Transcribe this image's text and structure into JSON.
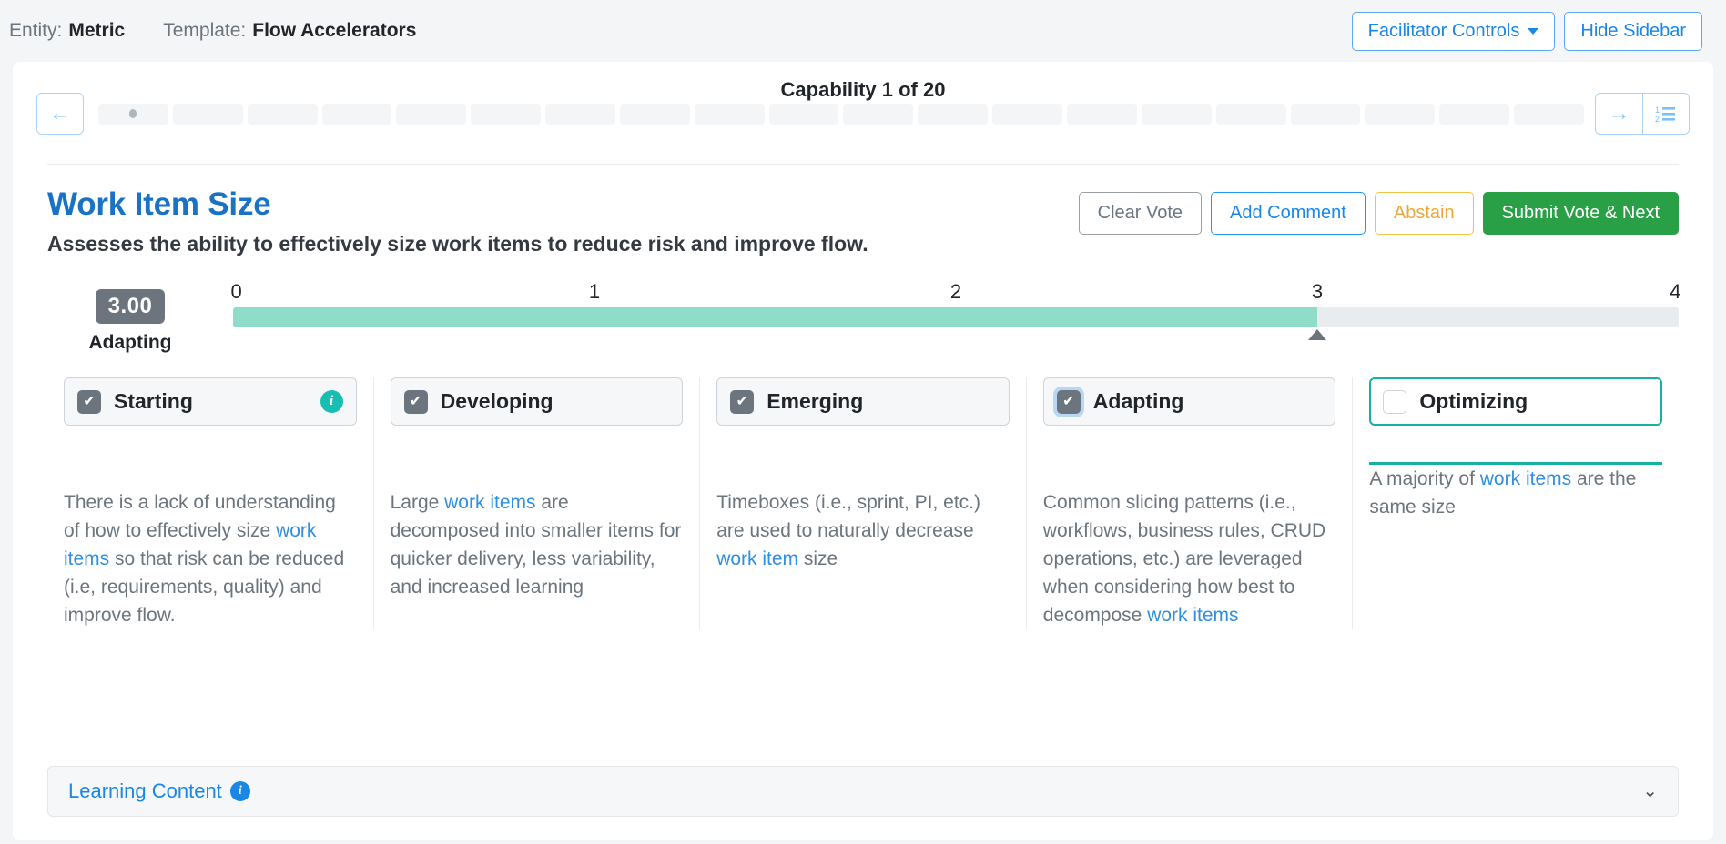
{
  "topbar": {
    "entity_label": "Entity:",
    "entity_value": "Metric",
    "template_label": "Template:",
    "template_value": "Flow Accelerators",
    "facilitator_controls": "Facilitator Controls",
    "hide_sidebar": "Hide Sidebar"
  },
  "nav": {
    "capability_counter": "Capability 1 of 20",
    "back_icon": "←",
    "forward_icon": "→",
    "list_icon": "☰",
    "total_segments": 20,
    "current_index": 1
  },
  "capability": {
    "name": "Work Item Size",
    "description": "Assesses the ability to effectively size work items to reduce risk and improve flow."
  },
  "actions": {
    "clear_vote": "Clear Vote",
    "add_comment": "Add Comment",
    "abstain": "Abstain",
    "submit": "Submit Vote & Next"
  },
  "gauge": {
    "score": "3.00",
    "score_label": "Adapting",
    "ticks": [
      "0",
      "1",
      "2",
      "3",
      "4"
    ],
    "min": 0,
    "max": 4,
    "value": 3,
    "fill_color": "#8fdcc9",
    "track_color": "#e9ecef",
    "marker_color": "#6c757d"
  },
  "levels": [
    {
      "name": "Starting",
      "checked": true,
      "selected": false,
      "focused": false,
      "has_info": true,
      "info_glyph": "i",
      "check_glyph": "✔",
      "text_parts": [
        {
          "t": "There is a lack of understanding of how to effectively size ",
          "link": false
        },
        {
          "t": "work items",
          "link": true
        },
        {
          "t": " so that risk can be reduced (i.e, requirements, quality) and improve flow.",
          "link": false
        }
      ]
    },
    {
      "name": "Developing",
      "checked": true,
      "selected": false,
      "focused": false,
      "has_info": false,
      "check_glyph": "✔",
      "text_parts": [
        {
          "t": "Large ",
          "link": false
        },
        {
          "t": "work items",
          "link": true
        },
        {
          "t": " are decomposed into smaller items for quicker delivery, less variability, and increased learning",
          "link": false
        }
      ]
    },
    {
      "name": "Emerging",
      "checked": true,
      "selected": false,
      "focused": false,
      "has_info": false,
      "check_glyph": "✔",
      "text_parts": [
        {
          "t": "Timeboxes (i.e., sprint, PI, etc.) are used to naturally decrease ",
          "link": false
        },
        {
          "t": "work item",
          "link": true
        },
        {
          "t": " size",
          "link": false
        }
      ]
    },
    {
      "name": "Adapting",
      "checked": true,
      "selected": false,
      "focused": true,
      "has_info": false,
      "check_glyph": "✔",
      "text_parts": [
        {
          "t": "Common slicing patterns (i.e., workflows, business rules, CRUD operations, etc.) are leveraged when considering how best to decompose ",
          "link": false
        },
        {
          "t": "work items",
          "link": true
        }
      ]
    },
    {
      "name": "Optimizing",
      "checked": false,
      "selected": true,
      "focused": false,
      "has_info": false,
      "check_glyph": "",
      "text_parts": [
        {
          "t": "A majority of ",
          "link": false
        },
        {
          "t": "work items",
          "link": true
        },
        {
          "t": " are the same size",
          "link": false
        }
      ]
    }
  ],
  "learning": {
    "label": "Learning Content",
    "info_glyph": "i",
    "chevron": "⌄"
  },
  "colors": {
    "accent_blue": "#1a87e6",
    "title_blue": "#1a72c4",
    "teal": "#17b0a7",
    "green": "#29a046",
    "amber": "#e8a93a",
    "gray": "#6c757d"
  }
}
